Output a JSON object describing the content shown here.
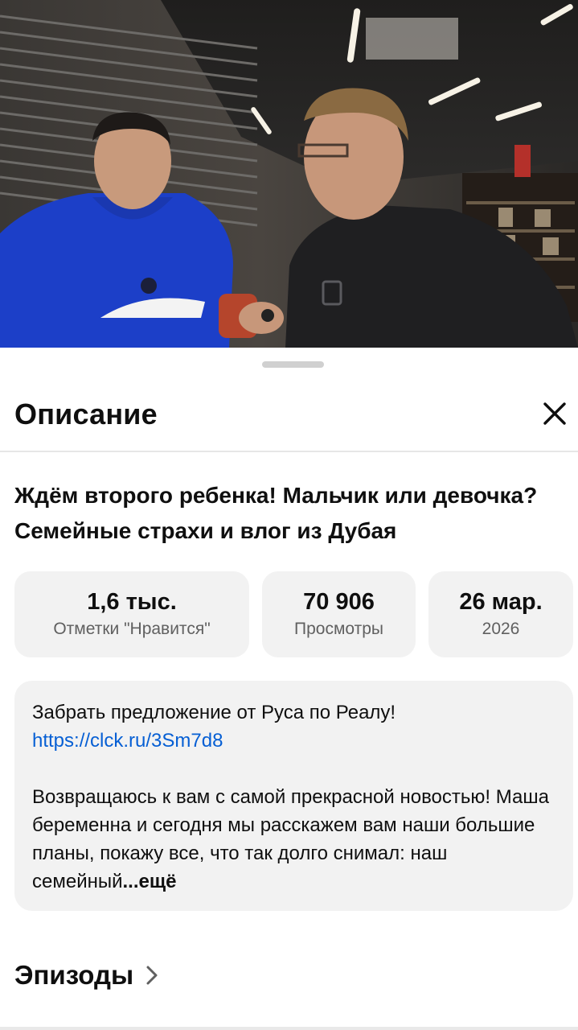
{
  "sheet": {
    "title": "Описание",
    "close_icon": "close-icon"
  },
  "video": {
    "title": "Ждём второго ребенка! Мальчик или девочка? Семейные страхи и влог из Дубая"
  },
  "stats": [
    {
      "value": "1,6 тыс.",
      "label": "Отметки \"Нравится\""
    },
    {
      "value": "70 906",
      "label": "Просмотры"
    },
    {
      "value": "26 мар.",
      "label": "2026"
    }
  ],
  "description": {
    "line1_text": "Забрать предложение от Руса по Реалу! ",
    "line1_link": "https://clck.ru/3Sm7d8",
    "body": "Возвращаюсь к вам с самой прекрасной новостью! Маша беременна и сегодня мы расскажем вам наши большие планы, покажу все, что так долго снимал: наш семейный",
    "more": "...ещё"
  },
  "episodes": {
    "label": "Эпизоды",
    "icon": "chevron-right-icon"
  },
  "colors": {
    "link": "#065fd4",
    "card_bg": "#f2f2f2"
  }
}
